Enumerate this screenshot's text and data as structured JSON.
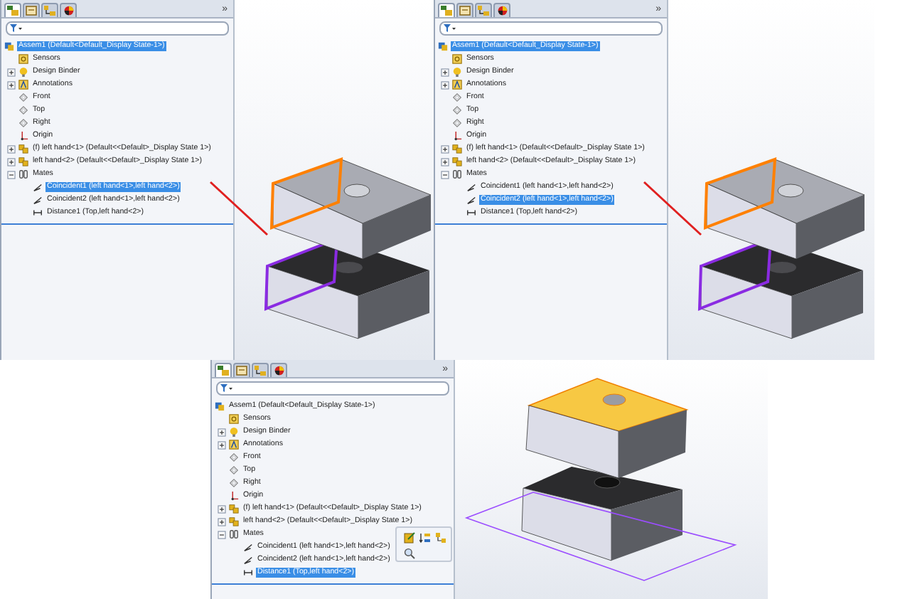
{
  "screens": [
    {
      "tabs": [
        {
          "kind": "feature",
          "selected": true
        },
        {
          "kind": "property",
          "selected": false
        },
        {
          "kind": "config",
          "selected": false
        },
        {
          "kind": "appearance",
          "selected": false
        }
      ],
      "chevron": "»",
      "tree": {
        "label": "Assem1 (Default<Default_Display State-1>)",
        "kind": "assembly",
        "selected": true,
        "children": [
          {
            "label": "Sensors",
            "kind": "sensors",
            "selected": false
          },
          {
            "label": "Design Binder",
            "kind": "binder",
            "expanded": false,
            "selected": false
          },
          {
            "label": "Annotations",
            "kind": "annotations",
            "expanded": false,
            "selected": false
          },
          {
            "label": "Front",
            "kind": "plane",
            "selected": false
          },
          {
            "label": "Top",
            "kind": "plane",
            "selected": false
          },
          {
            "label": "Right",
            "kind": "plane",
            "selected": false
          },
          {
            "label": "Origin",
            "kind": "origin",
            "selected": false
          },
          {
            "label": "(f) left hand<1> (Default<<Default>_Display State 1>)",
            "kind": "part",
            "expanded": false,
            "selected": false
          },
          {
            "label": "left hand<2> (Default<<Default>_Display State 1>)",
            "kind": "part",
            "expanded": false,
            "selected": false
          },
          {
            "label": "Mates",
            "kind": "mates",
            "expanded": true,
            "selected": false,
            "children": [
              {
                "label": "Coincident1 (left hand<1>,left hand<2>)",
                "kind": "coincident",
                "selected": true
              },
              {
                "label": "Coincident2 (left hand<1>,left hand<2>)",
                "kind": "coincident",
                "selected": false
              },
              {
                "label": "Distance1 (Top,left hand<2>)",
                "kind": "distance",
                "selected": false
              }
            ]
          }
        ]
      },
      "view": {
        "kind": "front_faces",
        "leader_line": true
      },
      "context_toolbar": false
    },
    {
      "tabs": [
        {
          "kind": "feature",
          "selected": true
        },
        {
          "kind": "property",
          "selected": false
        },
        {
          "kind": "config",
          "selected": false
        },
        {
          "kind": "appearance",
          "selected": false
        }
      ],
      "chevron": "»",
      "tree": {
        "label": "Assem1 (Default<Default_Display State-1>)",
        "kind": "assembly",
        "selected": true,
        "children": [
          {
            "label": "Sensors",
            "kind": "sensors",
            "selected": false
          },
          {
            "label": "Design Binder",
            "kind": "binder",
            "expanded": false,
            "selected": false
          },
          {
            "label": "Annotations",
            "kind": "annotations",
            "expanded": false,
            "selected": false
          },
          {
            "label": "Front",
            "kind": "plane",
            "selected": false
          },
          {
            "label": "Top",
            "kind": "plane",
            "selected": false
          },
          {
            "label": "Right",
            "kind": "plane",
            "selected": false
          },
          {
            "label": "Origin",
            "kind": "origin",
            "selected": false
          },
          {
            "label": "(f) left hand<1> (Default<<Default>_Display State 1>)",
            "kind": "part",
            "expanded": false,
            "selected": false
          },
          {
            "label": "left hand<2> (Default<<Default>_Display State 1>)",
            "kind": "part",
            "expanded": false,
            "selected": false
          },
          {
            "label": "Mates",
            "kind": "mates",
            "expanded": true,
            "selected": false,
            "children": [
              {
                "label": "Coincident1 (left hand<1>,left hand<2>)",
                "kind": "coincident",
                "selected": false
              },
              {
                "label": "Coincident2 (left hand<1>,left hand<2>)",
                "kind": "coincident",
                "selected": true
              },
              {
                "label": "Distance1 (Top,left hand<2>)",
                "kind": "distance",
                "selected": false
              }
            ]
          }
        ]
      },
      "view": {
        "kind": "front_faces",
        "leader_line": true
      },
      "context_toolbar": false
    },
    {
      "tabs": [
        {
          "kind": "feature",
          "selected": true
        },
        {
          "kind": "property",
          "selected": false
        },
        {
          "kind": "config",
          "selected": false
        },
        {
          "kind": "appearance",
          "selected": false
        }
      ],
      "chevron": "»",
      "tree": {
        "label": "Assem1 (Default<Default_Display State-1>)",
        "kind": "assembly",
        "selected": false,
        "children": [
          {
            "label": "Sensors",
            "kind": "sensors",
            "selected": false
          },
          {
            "label": "Design Binder",
            "kind": "binder",
            "expanded": false,
            "selected": false
          },
          {
            "label": "Annotations",
            "kind": "annotations",
            "expanded": false,
            "selected": false
          },
          {
            "label": "Front",
            "kind": "plane",
            "selected": false
          },
          {
            "label": "Top",
            "kind": "plane",
            "selected": false
          },
          {
            "label": "Right",
            "kind": "plane",
            "selected": false
          },
          {
            "label": "Origin",
            "kind": "origin",
            "selected": false
          },
          {
            "label": "(f) left hand<1> (Default<<Default>_Display State 1>)",
            "kind": "part",
            "expanded": false,
            "selected": false
          },
          {
            "label": "left hand<2> (Default<<Default>_Display State 1>)",
            "kind": "part",
            "expanded": false,
            "selected": false
          },
          {
            "label": "Mates",
            "kind": "mates",
            "expanded": true,
            "selected": false,
            "children": [
              {
                "label": "Coincident1 (left hand<1>,left hand<2>)",
                "kind": "coincident",
                "selected": false
              },
              {
                "label": "Coincident2 (left hand<1>,left hand<2>)",
                "kind": "coincident",
                "selected": false
              },
              {
                "label": "Distance1 (Top,left hand<2>)",
                "kind": "distance",
                "selected": true
              }
            ]
          }
        ]
      },
      "view": {
        "kind": "top_face_plane",
        "leader_line": false
      },
      "context_toolbar": true
    }
  ]
}
